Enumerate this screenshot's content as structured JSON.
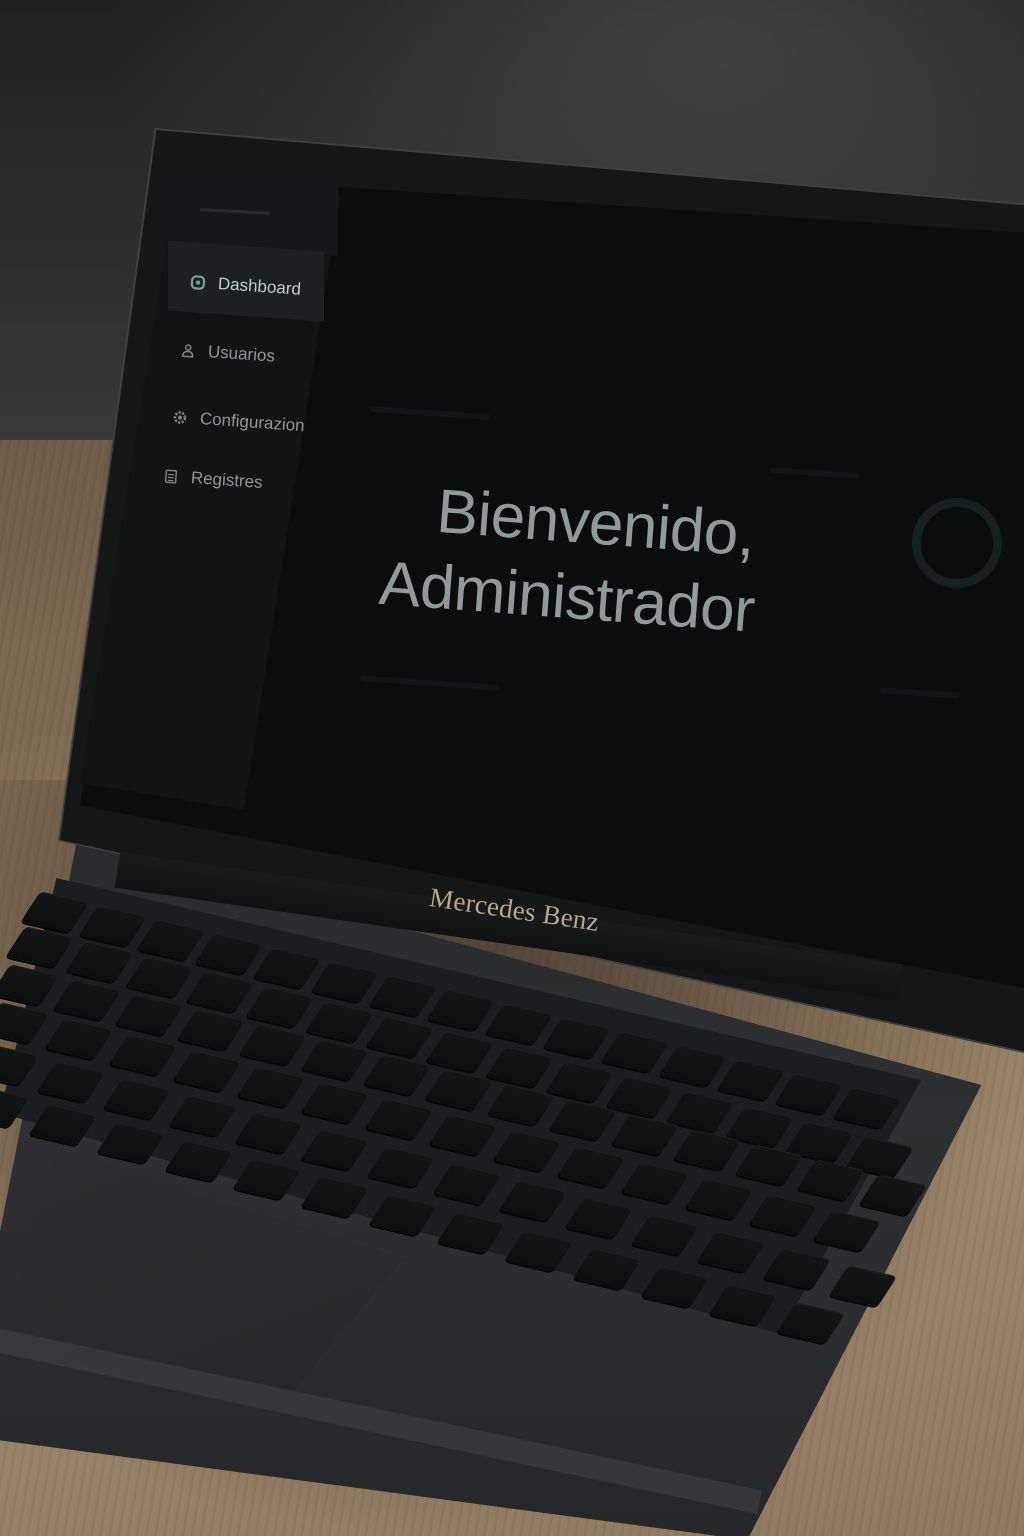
{
  "sidebar": {
    "items": [
      {
        "label": "Dashboard",
        "icon": "dashboard-icon",
        "active": true
      },
      {
        "label": "Usuarios",
        "icon": "user-icon",
        "active": false
      },
      {
        "label": "Configurazion",
        "icon": "gear-icon",
        "active": false
      },
      {
        "label": "Registres",
        "icon": "list-icon",
        "active": false
      }
    ]
  },
  "main": {
    "welcome_line1": "Bienvenido,",
    "welcome_line2": "Administrador"
  },
  "device": {
    "brand": "Mercedes Benz"
  },
  "colors": {
    "accent": "#6aa79e",
    "screen_bg": "#0b0c0c",
    "sidebar_bg": "#121414",
    "text": "#8f9a9b",
    "brand": "#b9a78e"
  }
}
